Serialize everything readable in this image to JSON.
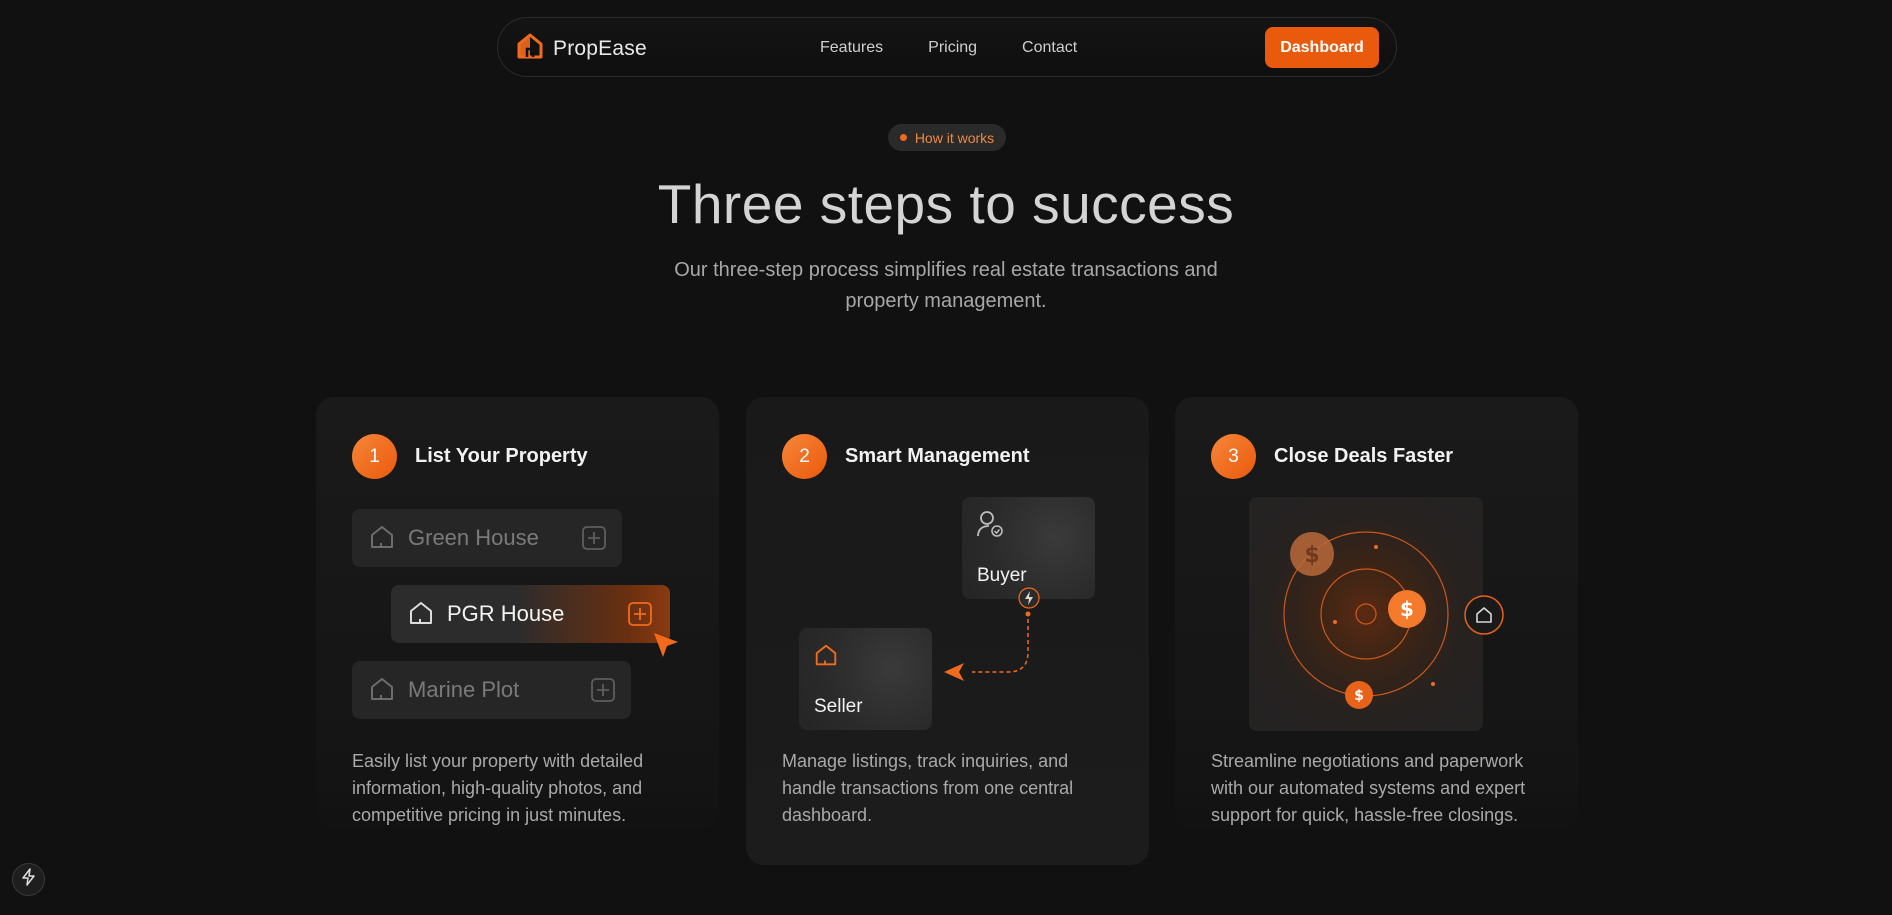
{
  "nav": {
    "brand": "PropEase",
    "links": [
      "Features",
      "Pricing",
      "Contact"
    ],
    "cta": "Dashboard"
  },
  "hero": {
    "pill": "How it works",
    "title": "Three steps to success",
    "subtitle": "Our three-step process simplifies real estate transactions and property management."
  },
  "steps": [
    {
      "num": "1",
      "title": "List Your Property",
      "items": [
        "Green House",
        "PGR House",
        "Marine Plot"
      ],
      "desc": "Easily list your property with detailed information, high-quality photos, and competitive pricing in just minutes."
    },
    {
      "num": "2",
      "title": "Smart Management",
      "buyer": "Buyer",
      "seller": "Seller",
      "desc": "Manage listings, track inquiries, and handle transactions from one central dashboard."
    },
    {
      "num": "3",
      "title": "Close Deals Faster",
      "desc": "Streamline negotiations and paperwork with our automated systems and expert support for quick, hassle-free closings."
    }
  ],
  "colors": {
    "accent": "#ea5a0c",
    "accent_light": "#f7863a",
    "background": "#111111"
  },
  "icons": [
    "house-logo-icon",
    "house-icon",
    "plus-icon",
    "cursor-arrow-icon",
    "user-check-icon",
    "bolt-icon",
    "dollar-icon"
  ]
}
